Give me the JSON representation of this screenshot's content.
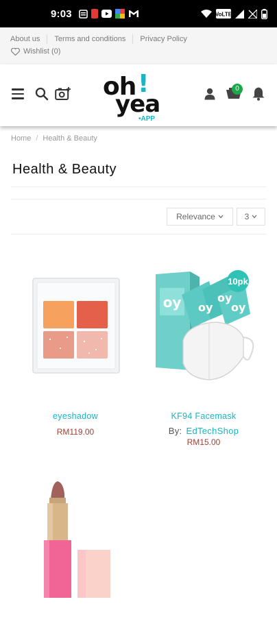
{
  "status_bar": {
    "time": "9:03",
    "icons": [
      "calendar-icon",
      "app-red-icon",
      "youtube-icon",
      "app-multicolor-icon",
      "gmail-icon",
      "wifi-icon",
      "volte-icon",
      "signal-icon",
      "no-sim-icon",
      "battery-icon"
    ]
  },
  "top_links": {
    "about": "About us",
    "terms": "Terms and conditions",
    "privacy": "Privacy Policy",
    "wishlist": "Wishlist (0)"
  },
  "header": {
    "logo": {
      "line1": "oh",
      "bang": "!",
      "line2": "yea",
      "suffix": "•APP"
    },
    "cart_count": "0",
    "colors": {
      "brand": "#19b5c4",
      "badge": "#1aa84a"
    }
  },
  "breadcrumb": {
    "home": "Home",
    "separator": "/",
    "current": "Health & Beauty"
  },
  "page_title": "Health & Beauty",
  "toolbar": {
    "sort_value": "Relevance",
    "per_page_value": "3"
  },
  "products": [
    {
      "name": "eyeshadow",
      "price": "RM119.00",
      "image": "eyeshadow-palette"
    },
    {
      "name": "KF94 Facemask",
      "by_label": "By:",
      "shop": "EdTechShop",
      "price": "RM15.00",
      "image": "facemask-box",
      "pack_label": "10pk"
    },
    {
      "name": "",
      "price": "",
      "image": "pink-lipstick"
    }
  ]
}
